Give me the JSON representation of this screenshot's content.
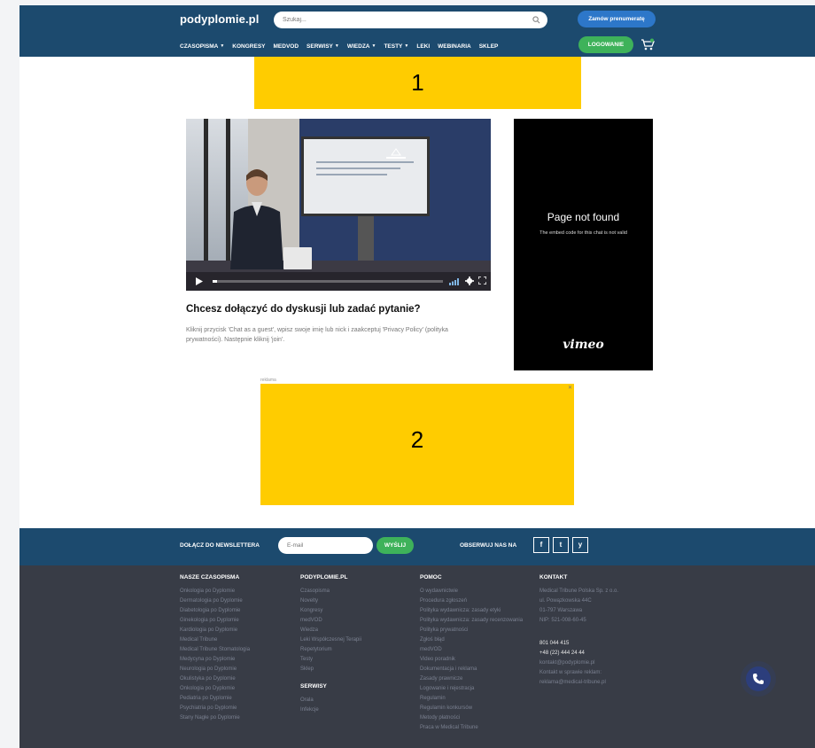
{
  "header": {
    "logo": "podyplomie.pl",
    "search_placeholder": "Szukaj...",
    "subscribe_label": "Zamów prenumeratę",
    "login_label": "LOGOWANIE",
    "nav": [
      {
        "label": "CZASOPISMA",
        "caret": true
      },
      {
        "label": "KONGRESY",
        "caret": false
      },
      {
        "label": "MEDVOD",
        "caret": false
      },
      {
        "label": "SERWISY",
        "caret": true
      },
      {
        "label": "WIEDZA",
        "caret": true
      },
      {
        "label": "TESTY",
        "caret": true
      },
      {
        "label": "LEKI",
        "caret": false
      },
      {
        "label": "WEBINARIA",
        "caret": false
      },
      {
        "label": "SKLEP",
        "caret": false
      }
    ]
  },
  "ads": {
    "ad1_label": "1",
    "ad2_label": "2",
    "ad2_small": "reklama"
  },
  "video": {
    "progress": 0.02
  },
  "chat": {
    "title": "Chcesz dołączyć do dyskusji lub zadać pytanie?",
    "description": "Kliknij przycisk 'Chat as a guest', wpisz swoje imię lub nick i zaakceptuj 'Privacy Policy' (polityka prywatności). Następnie kliknij 'join'."
  },
  "vimeo": {
    "title": "Page not found",
    "subtitle": "The embed code for this chat is not valid",
    "logo": "vimeo"
  },
  "newsletter": {
    "label": "DOŁĄCZ DO NEWSLETTERA",
    "email_placeholder": "E-mail",
    "send_label": "WYŚLIJ",
    "follow_label": "OBSERWUJ NAS NA",
    "social": [
      "f",
      "t",
      "y"
    ]
  },
  "footer": {
    "journals": {
      "title": "NASZE CZASOPISMA",
      "items": [
        "Onkologia po Dyplomie",
        "Dermatologia po Dyplomie",
        "Diabetologia po Dyplomie",
        "Ginekologia po Dyplomie",
        "Kardiologia po Dyplomie",
        "Medical Tribune",
        "Medical Tribune Stomatologia",
        "Medycyna po Dyplomie",
        "Neurologia po Dyplomie",
        "Okulistyka po Dyplomie",
        "Onkologia po Dyplomie",
        "Pediatria po Dyplomie",
        "Psychiatria po Dyplomie",
        "Stany Nagłe po Dyplomie"
      ]
    },
    "site": {
      "title": "PODYPLOMIE.PL",
      "items": [
        "Czasopisma",
        "Novelty",
        "Kongresy",
        "medVOD",
        "Wiedza",
        "Leki Współczesnej Terapii",
        "Repetytorium",
        "Testy",
        "Sklep"
      ],
      "services_title": "SERWISY",
      "services": [
        "Orala",
        "Infekcje"
      ]
    },
    "help": {
      "title": "POMOC",
      "items": [
        "O wydawnictwie",
        "Procedura zgłoszeń",
        "Polityka wydawnicza: zasady etyki",
        "Polityka wydawnicza: zasady recenzowania",
        "Polityka prywatności",
        "Zgłoś błąd",
        "medVOD",
        "Video poradnik",
        "Dokumentacja i reklama",
        "Zasady prawnicze",
        "Logowanie i rejestracja",
        "Regulamin",
        "Regulamin konkursów",
        "Metody płatności",
        "Praca w Medical Tribune"
      ]
    },
    "contact": {
      "title": "KONTAKT",
      "address": [
        "Medical Tribune Polska Sp. z o.o.",
        "ul. Powązkowska 44C",
        "01-797 Warszawa",
        "NIP: 521-008-60-45"
      ],
      "phones": [
        "801 044 415",
        "+48 (22) 444 24 44"
      ],
      "emails": [
        "kontakt@podyplomie.pl",
        "",
        "Kontakt w sprawie reklam:",
        "reklama@medical-tribune.pl"
      ]
    }
  },
  "colors": {
    "brand": "#1c4a6e",
    "accent_green": "#3eb25a",
    "accent_blue": "#2d77c9",
    "ad_yellow": "#ffcc00",
    "footer": "#383c46"
  }
}
